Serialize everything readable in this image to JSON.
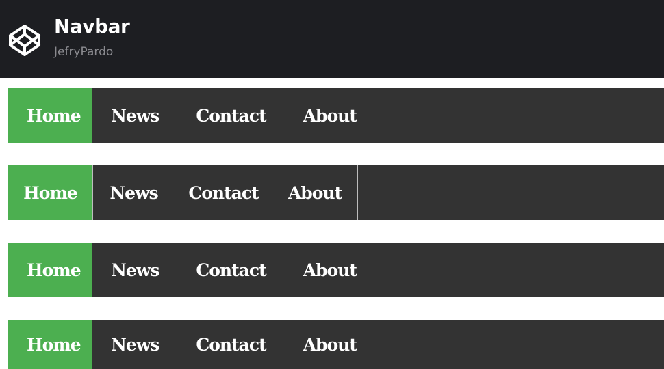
{
  "header": {
    "title": "Navbar",
    "author": "JefryPardo",
    "logo_icon": "codepen-logo-icon"
  },
  "colors": {
    "header_bg": "#1d1e22",
    "navbar_bg": "#333333",
    "active_bg": "#4caf50",
    "text": "#ffffff",
    "divider": "#bdbdbd"
  },
  "navbars": [
    {
      "style": "plain",
      "active": "Home",
      "items": [
        {
          "label": "Home"
        },
        {
          "label": "News"
        },
        {
          "label": "Contact"
        },
        {
          "label": "About"
        }
      ]
    },
    {
      "style": "divided",
      "active": "Home",
      "items": [
        {
          "label": "Home"
        },
        {
          "label": "News"
        },
        {
          "label": "Contact"
        },
        {
          "label": "About"
        }
      ]
    },
    {
      "style": "plain",
      "active": "Home",
      "items": [
        {
          "label": "Home"
        },
        {
          "label": "News"
        },
        {
          "label": "Contact"
        },
        {
          "label": "About"
        }
      ]
    },
    {
      "style": "plain",
      "active": "Home",
      "items": [
        {
          "label": "Home"
        },
        {
          "label": "News"
        },
        {
          "label": "Contact"
        },
        {
          "label": "About"
        }
      ]
    }
  ]
}
